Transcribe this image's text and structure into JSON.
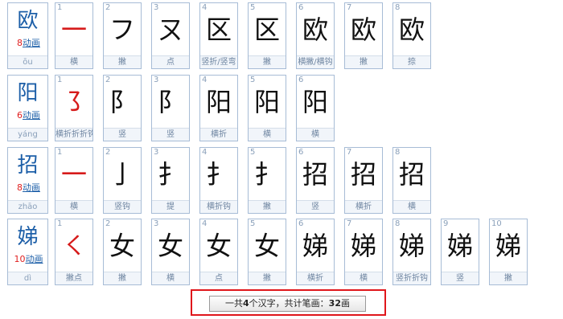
{
  "rows": [
    {
      "char": "欧",
      "count": "8",
      "link": "动画",
      "pinyin": "ōu",
      "strokes": [
        {
          "n": "1",
          "g": "一",
          "name": "横"
        },
        {
          "n": "2",
          "g": "フ",
          "name": "撇"
        },
        {
          "n": "3",
          "g": "ㄡ",
          "name": "点"
        },
        {
          "n": "4",
          "g": "区",
          "name": "竖折/竖弯"
        },
        {
          "n": "5",
          "g": "区",
          "name": "撇"
        },
        {
          "n": "6",
          "g": "欧",
          "name": "横撇/横钩"
        },
        {
          "n": "7",
          "g": "欧",
          "name": "撇"
        },
        {
          "n": "8",
          "g": "欧",
          "name": "捺"
        }
      ]
    },
    {
      "char": "阳",
      "count": "6",
      "link": "动画",
      "pinyin": "yáng",
      "strokes": [
        {
          "n": "1",
          "g": "㇌",
          "name": "横折折折钩"
        },
        {
          "n": "2",
          "g": "阝",
          "name": "竖"
        },
        {
          "n": "3",
          "g": "阝",
          "name": "竖"
        },
        {
          "n": "4",
          "g": "阳",
          "name": "横折"
        },
        {
          "n": "5",
          "g": "阳",
          "name": "横"
        },
        {
          "n": "6",
          "g": "阳",
          "name": "横"
        }
      ]
    },
    {
      "char": "招",
      "count": "8",
      "link": "动画",
      "pinyin": "zhāo",
      "strokes": [
        {
          "n": "1",
          "g": "一",
          "name": "横"
        },
        {
          "n": "2",
          "g": "亅",
          "name": "竖钩"
        },
        {
          "n": "3",
          "g": "扌",
          "name": "提"
        },
        {
          "n": "4",
          "g": "扌",
          "name": "横折钩"
        },
        {
          "n": "5",
          "g": "扌",
          "name": "撇"
        },
        {
          "n": "6",
          "g": "招",
          "name": "竖"
        },
        {
          "n": "7",
          "g": "招",
          "name": "横折"
        },
        {
          "n": "8",
          "g": "招",
          "name": "横"
        }
      ]
    },
    {
      "char": "娣",
      "count": "10",
      "link": "动画",
      "pinyin": "dì",
      "strokes": [
        {
          "n": "1",
          "g": "㇛",
          "name": "撇点"
        },
        {
          "n": "2",
          "g": "女",
          "name": "撇"
        },
        {
          "n": "3",
          "g": "女",
          "name": "横"
        },
        {
          "n": "4",
          "g": "女",
          "name": "点"
        },
        {
          "n": "5",
          "g": "女",
          "name": "撇"
        },
        {
          "n": "6",
          "g": "娣",
          "name": "横折"
        },
        {
          "n": "7",
          "g": "娣",
          "name": "横"
        },
        {
          "n": "8",
          "g": "娣",
          "name": "竖折折钩"
        },
        {
          "n": "9",
          "g": "娣",
          "name": "竖"
        },
        {
          "n": "10",
          "g": "娣",
          "name": "撇"
        }
      ]
    }
  ],
  "summary": {
    "prefix": "一共",
    "chars": "4",
    "mid": "个汉字，共计笔画：",
    "strokes": "32",
    "suffix": "画"
  }
}
